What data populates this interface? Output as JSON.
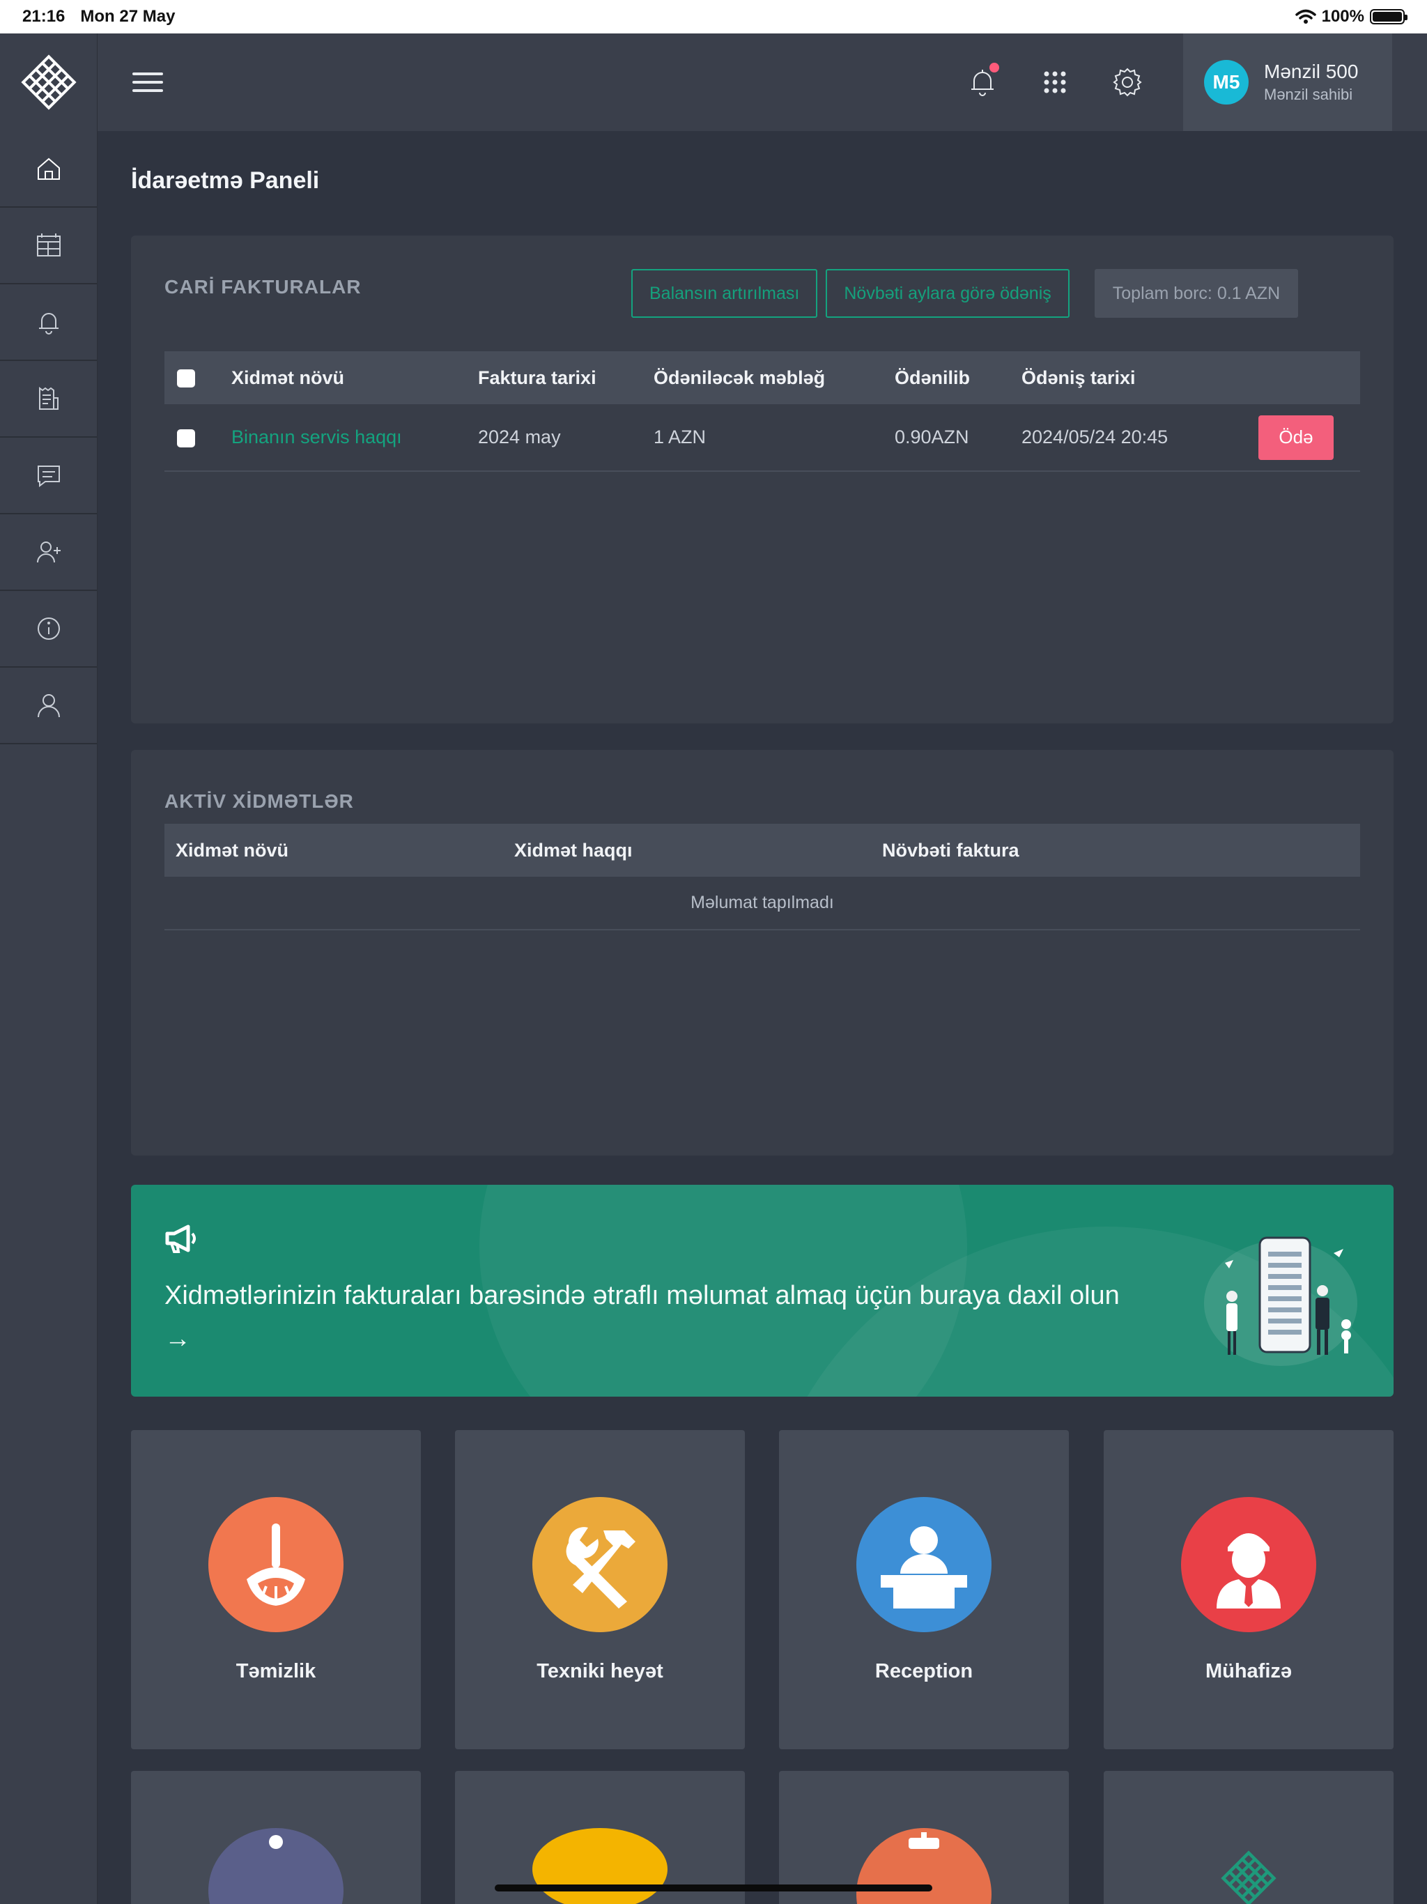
{
  "status_bar": {
    "time": "21:16",
    "date": "Mon 27 May",
    "battery": "100%"
  },
  "user": {
    "initials": "M5",
    "name": "Mənzil 500",
    "role": "Mənzil sahibi"
  },
  "page_title": "İdarəetmə Paneli",
  "current_invoices": {
    "title": "CARİ FAKTURALAR",
    "btn_balance": "Balansın artırılması",
    "btn_next_months": "Növbəti aylara görə ödəniş",
    "total_debt": "Toplam borc: 0.1 AZN",
    "columns": [
      "Xidmət növü",
      "Faktura tarixi",
      "Ödəniləcək məbləğ",
      "Ödənilib",
      "Ödəniş tarixi"
    ],
    "rows": [
      {
        "service": "Binanın servis haqqı",
        "invoice_date": "2024 may",
        "amount": "1 AZN",
        "paid": "0.90AZN",
        "pay_date": "2024/05/24 20:45",
        "action": "Ödə"
      }
    ]
  },
  "active_services": {
    "title": "AKTİV XİDMƏTLƏR",
    "columns": [
      "Xidmət növü",
      "Xidmət haqqı",
      "Növbəti faktura"
    ],
    "empty": "Məlumat tapılmadı"
  },
  "banner": {
    "text": "Xidmətlərinizin fakturaları barəsində ətraflı məlumat almaq üçün buraya daxil olun",
    "arrow": "→"
  },
  "tiles": [
    {
      "label": "Təmizlik",
      "color": "#f1774f",
      "icon": "broom-icon"
    },
    {
      "label": "Texniki heyət",
      "color": "#eba93a",
      "icon": "tools-icon"
    },
    {
      "label": "Reception",
      "color": "#3d8fd6",
      "icon": "reception-icon"
    },
    {
      "label": "Mühafizə",
      "color": "#e94047",
      "icon": "security-guard-icon"
    }
  ],
  "colors": {
    "accent_green": "#14a37f",
    "pay_pink": "#f35f7c",
    "banner": "#1b8a70"
  }
}
